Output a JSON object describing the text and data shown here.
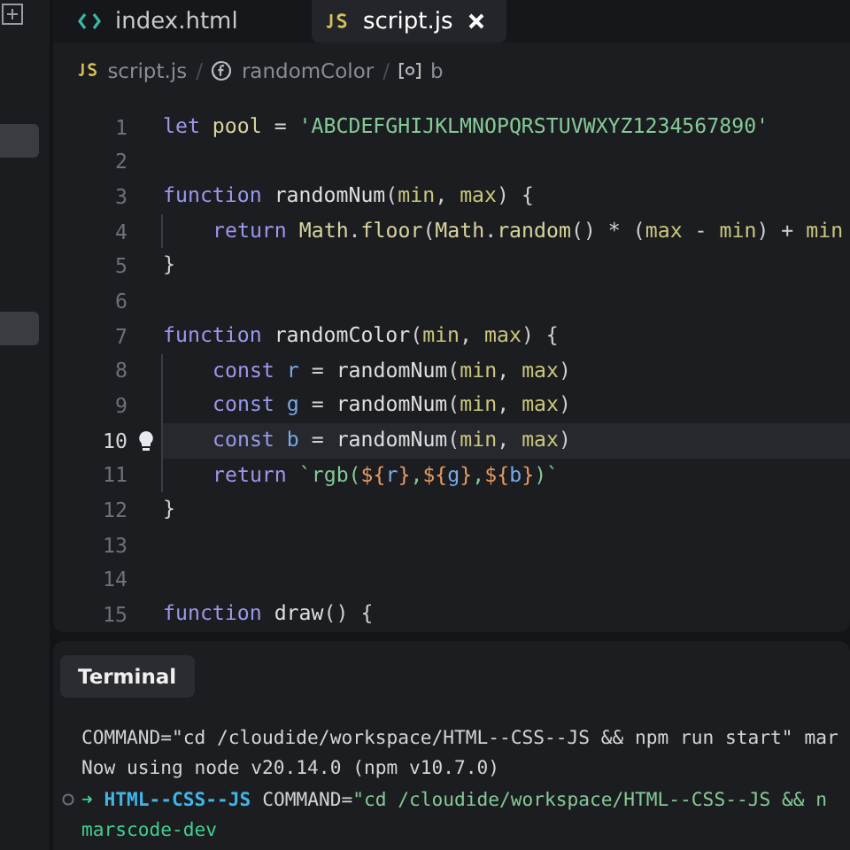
{
  "tabs": [
    {
      "label": "index.html",
      "selected": false
    },
    {
      "label": "script.js",
      "selected": true
    }
  ],
  "breadcrumb": [
    {
      "kind": "file",
      "label": "script.js"
    },
    {
      "kind": "function",
      "separator": "/",
      "label": "randomColor"
    },
    {
      "kind": "variable",
      "separator": "/",
      "label": "b"
    }
  ],
  "code_lines": [
    {
      "number": "1",
      "current": false,
      "indented": false,
      "tokens": [
        {
          "kind": "keyword",
          "text": "let "
        },
        {
          "kind": "variable",
          "text": "pool"
        },
        {
          "kind": "punct",
          "text": " = "
        },
        {
          "kind": "string",
          "text": "'ABCDEFGHIJKLMNOPQRSTUVWXYZ1234567890'"
        }
      ]
    },
    {
      "number": "2",
      "current": false,
      "indented": false
    },
    {
      "number": "3",
      "current": false,
      "indented": false,
      "tokens": [
        {
          "kind": "keyword",
          "text": "function "
        },
        {
          "kind": "name",
          "text": "randomNum"
        },
        {
          "kind": "punct",
          "text": "("
        },
        {
          "kind": "param",
          "text": "min"
        },
        {
          "kind": "punct",
          "text": ", "
        },
        {
          "kind": "param",
          "text": "max"
        },
        {
          "kind": "punct",
          "text": ") {"
        }
      ]
    },
    {
      "number": "4",
      "current": false,
      "indented": true,
      "tokens": [
        {
          "kind": "keyword",
          "text": "return "
        },
        {
          "kind": "variable",
          "text": "Math"
        },
        {
          "kind": "punct",
          "text": "."
        },
        {
          "kind": "variable",
          "text": "floor"
        },
        {
          "kind": "punct",
          "text": "("
        },
        {
          "kind": "variable",
          "text": "Math"
        },
        {
          "kind": "punct",
          "text": "."
        },
        {
          "kind": "variable",
          "text": "random"
        },
        {
          "kind": "punct",
          "text": "() * ("
        },
        {
          "kind": "param",
          "text": "max"
        },
        {
          "kind": "punct",
          "text": " - "
        },
        {
          "kind": "param",
          "text": "min"
        },
        {
          "kind": "punct",
          "text": ") + "
        },
        {
          "kind": "param",
          "text": "min"
        }
      ]
    },
    {
      "number": "5",
      "current": false,
      "indented": false,
      "tokens": [
        {
          "kind": "punct",
          "text": "}"
        }
      ]
    },
    {
      "number": "6",
      "current": false,
      "indented": false
    },
    {
      "number": "7",
      "current": false,
      "indented": false,
      "tokens": [
        {
          "kind": "keyword",
          "text": "function "
        },
        {
          "kind": "name",
          "text": "randomColor"
        },
        {
          "kind": "punct",
          "text": "("
        },
        {
          "kind": "param",
          "text": "min"
        },
        {
          "kind": "punct",
          "text": ", "
        },
        {
          "kind": "param",
          "text": "max"
        },
        {
          "kind": "punct",
          "text": ") {"
        }
      ]
    },
    {
      "number": "8",
      "current": false,
      "indented": true,
      "tokens": [
        {
          "kind": "keyword",
          "text": "const "
        },
        {
          "kind": "constant",
          "text": "r"
        },
        {
          "kind": "punct",
          "text": " = "
        },
        {
          "kind": "name",
          "text": "randomNum"
        },
        {
          "kind": "punct",
          "text": "("
        },
        {
          "kind": "param",
          "text": "min"
        },
        {
          "kind": "punct",
          "text": ", "
        },
        {
          "kind": "param",
          "text": "max"
        },
        {
          "kind": "punct",
          "text": ")"
        }
      ]
    },
    {
      "number": "9",
      "current": false,
      "indented": true,
      "tokens": [
        {
          "kind": "keyword",
          "text": "const "
        },
        {
          "kind": "constant",
          "text": "g"
        },
        {
          "kind": "punct",
          "text": " = "
        },
        {
          "kind": "name",
          "text": "randomNum"
        },
        {
          "kind": "punct",
          "text": "("
        },
        {
          "kind": "param",
          "text": "min"
        },
        {
          "kind": "punct",
          "text": ", "
        },
        {
          "kind": "param",
          "text": "max"
        },
        {
          "kind": "punct",
          "text": ")"
        }
      ]
    },
    {
      "number": "10",
      "current": true,
      "indented": true,
      "tokens": [
        {
          "kind": "keyword",
          "text": "const "
        },
        {
          "kind": "constant",
          "text": "b"
        },
        {
          "kind": "punct",
          "text": " = "
        },
        {
          "kind": "name",
          "text": "randomNum"
        },
        {
          "kind": "punct",
          "text": "("
        },
        {
          "kind": "param",
          "text": "min"
        },
        {
          "kind": "punct",
          "text": ", "
        },
        {
          "kind": "param",
          "text": "max"
        },
        {
          "kind": "punct",
          "text": ")"
        }
      ]
    },
    {
      "number": "11",
      "current": false,
      "indented": true,
      "tokens": [
        {
          "kind": "keyword",
          "text": "return "
        },
        {
          "kind": "string",
          "text": "`rgb("
        },
        {
          "kind": "interp",
          "text": "${"
        },
        {
          "kind": "constant",
          "text": "r"
        },
        {
          "kind": "interp",
          "text": "}"
        },
        {
          "kind": "string",
          "text": ","
        },
        {
          "kind": "interp",
          "text": "${"
        },
        {
          "kind": "constant",
          "text": "g"
        },
        {
          "kind": "interp",
          "text": "}"
        },
        {
          "kind": "string",
          "text": ","
        },
        {
          "kind": "interp",
          "text": "${"
        },
        {
          "kind": "constant",
          "text": "b"
        },
        {
          "kind": "interp",
          "text": "}"
        },
        {
          "kind": "string",
          "text": ")`"
        }
      ]
    },
    {
      "number": "12",
      "current": false,
      "indented": false,
      "tokens": [
        {
          "kind": "punct",
          "text": "}"
        }
      ]
    },
    {
      "number": "13",
      "current": false,
      "indented": false
    },
    {
      "number": "14",
      "current": false,
      "indented": false
    },
    {
      "number": "15",
      "current": false,
      "indented": false,
      "tokens": [
        {
          "kind": "keyword",
          "text": "function "
        },
        {
          "kind": "name",
          "text": "draw"
        },
        {
          "kind": "punct",
          "text": "() {"
        }
      ]
    }
  ],
  "terminal": {
    "tab": "Terminal",
    "lines": [
      {
        "prompt": false,
        "tokens": [
          {
            "kind": "plain",
            "text": "COMMAND=\"cd /cloudide/workspace/HTML--CSS--JS && npm run start\" mar"
          }
        ]
      },
      {
        "prompt": false,
        "tokens": [
          {
            "kind": "plain",
            "text": "Now using node v20.14.0 (npm v10.7.0)"
          }
        ]
      },
      {
        "prompt": true,
        "tokens": [
          {
            "kind": "arrow",
            "text": "➜ "
          },
          {
            "kind": "dir",
            "text": "HTML--CSS--JS"
          },
          {
            "kind": "plain",
            "text": " COMMAND="
          },
          {
            "kind": "string",
            "text": "\"cd /cloudide/workspace/HTML--CSS--JS && n"
          }
        ]
      },
      {
        "prompt": false,
        "tokens": [
          {
            "kind": "success",
            "text": "marscode-dev"
          }
        ]
      }
    ]
  }
}
